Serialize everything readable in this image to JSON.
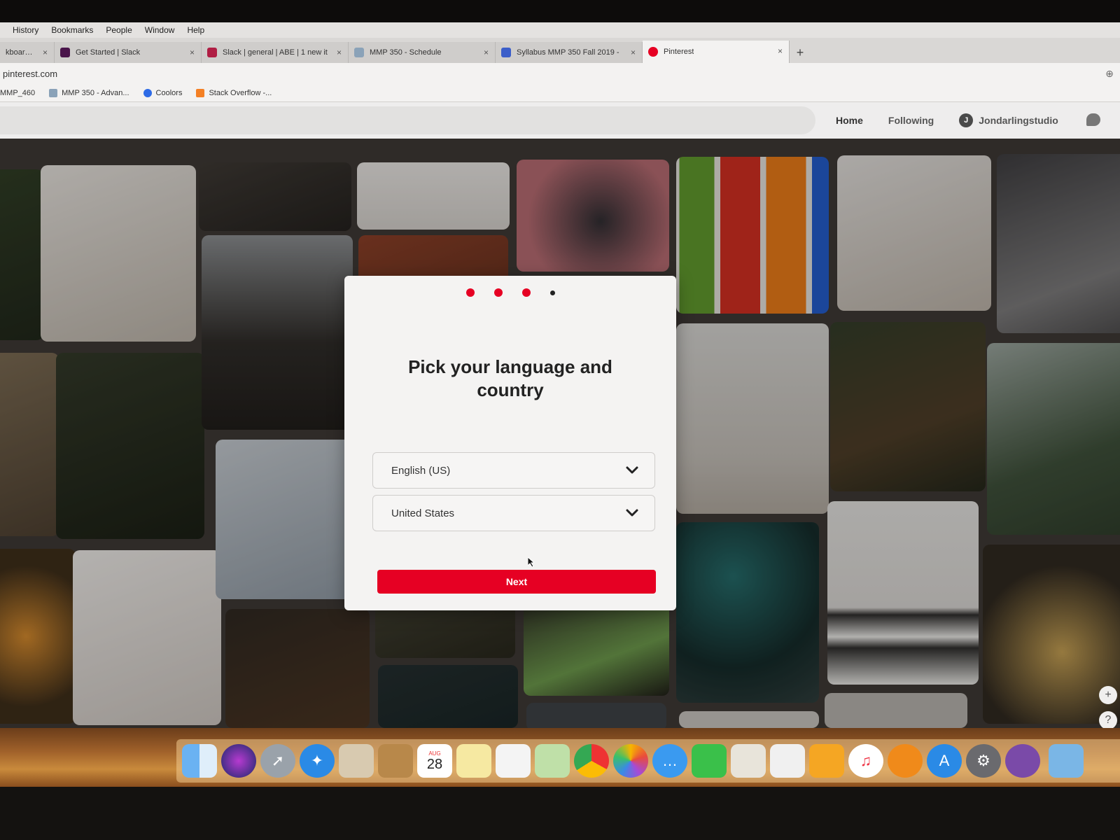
{
  "menubar": {
    "items": [
      "History",
      "Bookmarks",
      "People",
      "Window",
      "Help"
    ]
  },
  "tabs": [
    {
      "label": "kboard Le",
      "favicon_color": "#7a7a7a",
      "close": "×"
    },
    {
      "label": "Get Started | Slack",
      "favicon_color": "#4a154b",
      "close": "×"
    },
    {
      "label": "Slack | general | ABE | 1 new it",
      "favicon_color": "#b01e44",
      "close": "×"
    },
    {
      "label": "MMP 350 - Schedule",
      "favicon_color": "#8aa2b8",
      "close": "×"
    },
    {
      "label": "Syllabus MMP 350 Fall 2019 -",
      "favicon_color": "#3b5ec9",
      "close": "×"
    },
    {
      "label": "Pinterest",
      "favicon_color": "#e60023",
      "close": "×",
      "active": true
    }
  ],
  "new_tab": "+",
  "address": {
    "url": "pinterest.com"
  },
  "bookmarks": [
    {
      "label": "MMP_460",
      "icon_color": "#9a9a9a"
    },
    {
      "label": "MMP 350 - Advan...",
      "icon_color": "#8aa2b8"
    },
    {
      "label": "Coolors",
      "icon_color": "#2e6be6"
    },
    {
      "label": "Stack Overflow -...",
      "icon_color": "#f48024"
    }
  ],
  "pinterest": {
    "nav": {
      "home": "Home",
      "following": "Following",
      "avatar_initial": "J",
      "username": "Jondarlingstudio"
    }
  },
  "modal": {
    "steps_total": 4,
    "steps_completed": 3,
    "title": "Pick your language and country",
    "language": "English (US)",
    "country": "United States",
    "next_label": "Next"
  },
  "side_controls": {
    "plus": "+",
    "help": "?"
  },
  "dock": {
    "calendar_month": "AUG",
    "calendar_day": "28"
  },
  "colors": {
    "accent": "#e60023",
    "modal_bg": "#f4f3f2"
  }
}
